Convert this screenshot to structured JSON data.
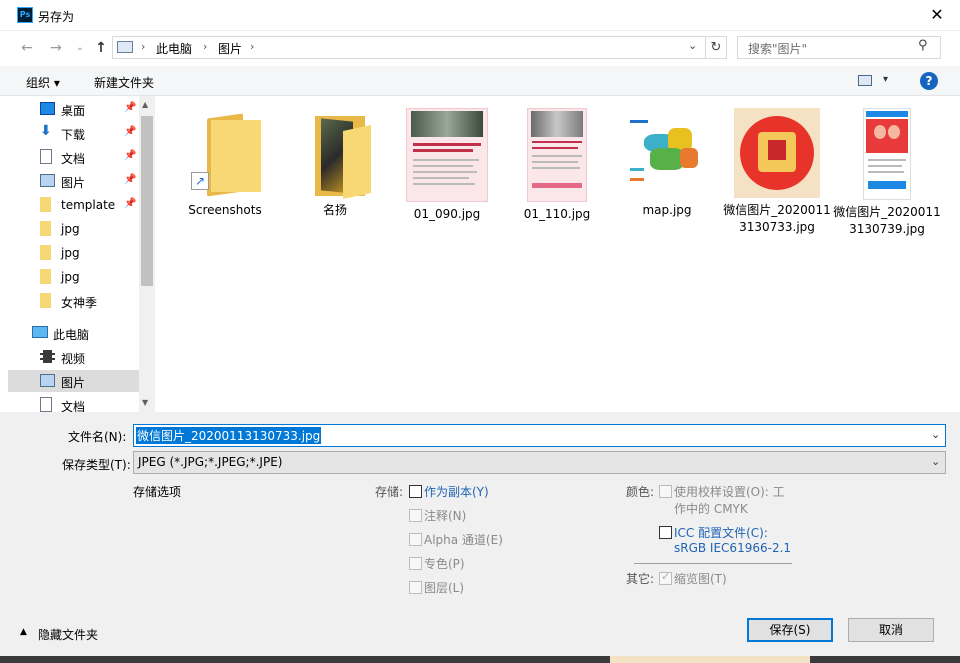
{
  "window": {
    "title": "另存为",
    "app_badge": "Ps",
    "close_label": "✕"
  },
  "nav": {
    "back": "←",
    "forward": "→",
    "up": "↑",
    "breadcrumbs": [
      "此电脑",
      "图片"
    ],
    "search_placeholder": "搜索\"图片\""
  },
  "toolbar": {
    "organize_label": "组织 ▾",
    "new_folder_label": "新建文件夹",
    "help_label": "?"
  },
  "sidebar": {
    "items": [
      {
        "label": "桌面",
        "icon": "desktop-icon",
        "pinned": true
      },
      {
        "label": "下载",
        "icon": "download-icon",
        "pinned": true
      },
      {
        "label": "文档",
        "icon": "document-icon",
        "pinned": true
      },
      {
        "label": "图片",
        "icon": "pictures-icon",
        "pinned": true
      },
      {
        "label": "template",
        "icon": "folder-icon",
        "pinned": true
      },
      {
        "label": "jpg",
        "icon": "folder-icon",
        "pinned": false
      },
      {
        "label": "jpg",
        "icon": "folder-icon",
        "pinned": false
      },
      {
        "label": "jpg",
        "icon": "folder-icon",
        "pinned": false
      },
      {
        "label": "女神季",
        "icon": "folder-icon",
        "pinned": false
      },
      {
        "label": "此电脑",
        "icon": "computer-icon",
        "pinned": false
      },
      {
        "label": "视频",
        "icon": "video-icon",
        "pinned": false
      },
      {
        "label": "图片",
        "icon": "pictures-icon",
        "pinned": false,
        "selected": true
      },
      {
        "label": "文档",
        "icon": "document-icon",
        "pinned": false
      }
    ]
  },
  "files": [
    {
      "name": "Screenshots",
      "kind": "folder-shortcut"
    },
    {
      "name": "名扬",
      "kind": "folder-photo"
    },
    {
      "name": "01_090.jpg",
      "kind": "doc-pink"
    },
    {
      "name": "01_110.jpg",
      "kind": "doc-pink"
    },
    {
      "name": "map.jpg",
      "kind": "map"
    },
    {
      "name": "微信图片_20200113130733.jpg",
      "kind": "wechat-red"
    },
    {
      "name": "微信图片_20200113130739.jpg",
      "kind": "wechat-phone"
    }
  ],
  "form": {
    "filename_label": "文件名(N):",
    "filename_value": "微信图片_20200113130733.jpg",
    "filetype_label": "保存类型(T):",
    "filetype_value": "JPEG (*.JPG;*.JPEG;*.JPE)",
    "save_options_title": "存储选项",
    "storage_label": "存储:",
    "as_copy": "作为副本(Y)",
    "notes": "注释(N)",
    "alpha": "Alpha 通道(E)",
    "spot": "专色(P)",
    "layers": "图层(L)",
    "color_label": "颜色:",
    "proof_setup": "使用校样设置(O):  工",
    "proof_setup_2": "作中的 CMYK",
    "icc_profile": "ICC 配置文件(C):",
    "icc_profile_2": "sRGB IEC61966-2.1",
    "other_label": "其它:",
    "thumbnail": "缩览图(T)",
    "hide_folders": "隐藏文件夹",
    "save_button": "保存(S)",
    "cancel_button": "取消"
  },
  "colors": {
    "accent": "#0078d7",
    "link_blue": "#1f64b5",
    "folder": "#f8d775"
  }
}
